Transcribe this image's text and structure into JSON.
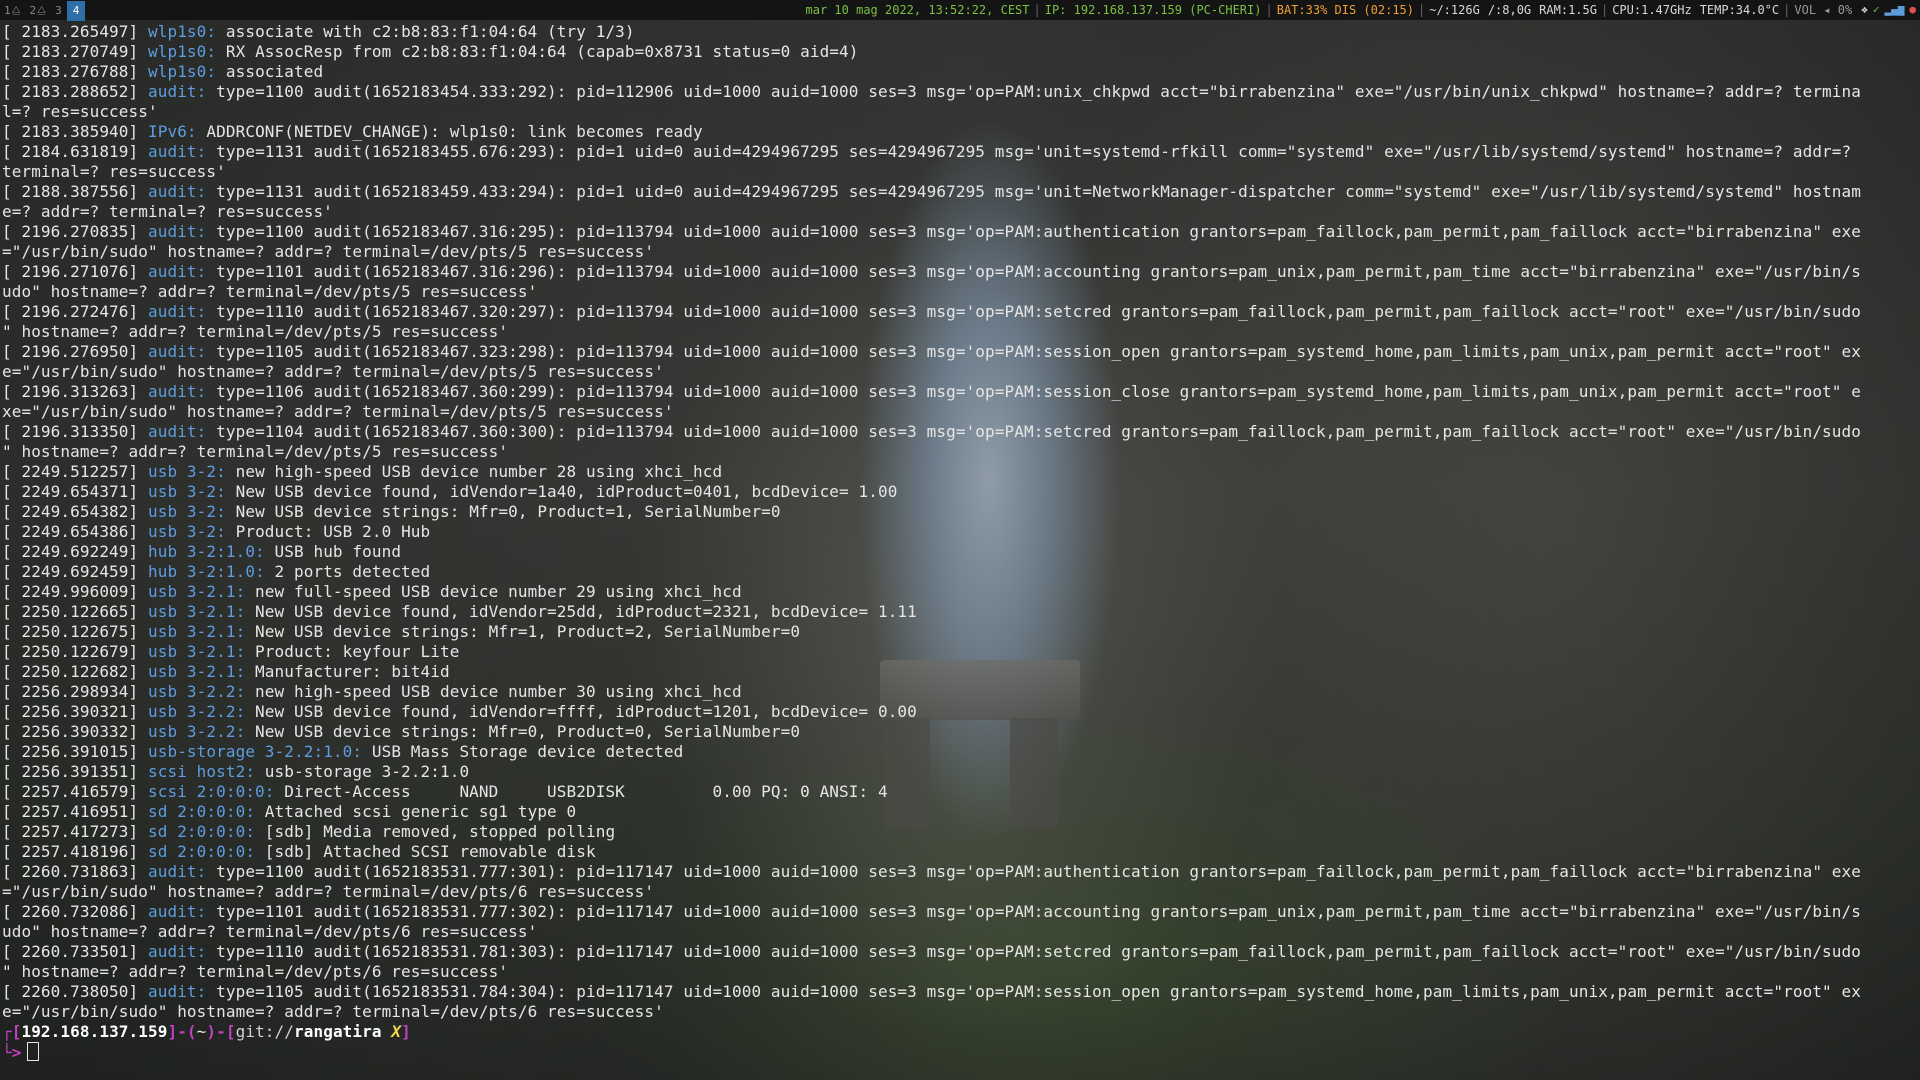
{
  "topbar": {
    "workspaces": [
      {
        "label": "1",
        "active": false
      },
      {
        "label": "2",
        "active": false
      },
      {
        "label": "3",
        "active": false
      },
      {
        "label": "4",
        "active": true
      }
    ],
    "datetime": "mar 10 mag 2022, 13:52:22, CEST",
    "ip": "IP: 192.168.137.159 (PC-CHERI)",
    "battery": "BAT:33% DIS (02:15)",
    "disk_home": "~/:126G",
    "disk_root": "/:8,0G",
    "ram": "RAM:1.5G",
    "cpu": "CPU:1.47GHz",
    "temp": "TEMP:34.0°C",
    "volume": "VOL",
    "volume_level": "0%",
    "colors": {
      "green": "#7bc043",
      "orange": "#f0a030",
      "active_ws": "#2f6fa8"
    }
  },
  "terminal": {
    "lines": [
      {
        "ts": "[ 2183.265497]",
        "src": "wlp1s0:",
        "msg": " associate with c2:b8:83:f1:04:64 (try 1/3)"
      },
      {
        "ts": "[ 2183.270749]",
        "src": "wlp1s0:",
        "msg": " RX AssocResp from c2:b8:83:f1:04:64 (capab=0x8731 status=0 aid=4)"
      },
      {
        "ts": "[ 2183.276788]",
        "src": "wlp1s0:",
        "msg": " associated"
      },
      {
        "ts": "[ 2183.288652]",
        "src": "audit:",
        "msg": " type=1100 audit(1652183454.333:292): pid=112906 uid=1000 auid=1000 ses=3 msg='op=PAM:unix_chkpwd acct=\"birrabenzina\" exe=\"/usr/bin/unix_chkpwd\" hostname=? addr=? termina"
      },
      {
        "ts": "",
        "src": "",
        "msg": "l=? res=success'"
      },
      {
        "ts": "[ 2183.385940]",
        "src": "IPv6:",
        "msg": " ADDRCONF(NETDEV_CHANGE): wlp1s0: link becomes ready"
      },
      {
        "ts": "[ 2184.631819]",
        "src": "audit:",
        "msg": " type=1131 audit(1652183455.676:293): pid=1 uid=0 auid=4294967295 ses=4294967295 msg='unit=systemd-rfkill comm=\"systemd\" exe=\"/usr/lib/systemd/systemd\" hostname=? addr=?"
      },
      {
        "ts": "",
        "src": "",
        "msg": "terminal=? res=success'"
      },
      {
        "ts": "[ 2188.387556]",
        "src": "audit:",
        "msg": " type=1131 audit(1652183459.433:294): pid=1 uid=0 auid=4294967295 ses=4294967295 msg='unit=NetworkManager-dispatcher comm=\"systemd\" exe=\"/usr/lib/systemd/systemd\" hostnam"
      },
      {
        "ts": "",
        "src": "",
        "msg": "e=? addr=? terminal=? res=success'"
      },
      {
        "ts": "[ 2196.270835]",
        "src": "audit:",
        "msg": " type=1100 audit(1652183467.316:295): pid=113794 uid=1000 auid=1000 ses=3 msg='op=PAM:authentication grantors=pam_faillock,pam_permit,pam_faillock acct=\"birrabenzina\" exe"
      },
      {
        "ts": "",
        "src": "",
        "msg": "=\"/usr/bin/sudo\" hostname=? addr=? terminal=/dev/pts/5 res=success'"
      },
      {
        "ts": "[ 2196.271076]",
        "src": "audit:",
        "msg": " type=1101 audit(1652183467.316:296): pid=113794 uid=1000 auid=1000 ses=3 msg='op=PAM:accounting grantors=pam_unix,pam_permit,pam_time acct=\"birrabenzina\" exe=\"/usr/bin/s"
      },
      {
        "ts": "",
        "src": "",
        "msg": "udo\" hostname=? addr=? terminal=/dev/pts/5 res=success'"
      },
      {
        "ts": "[ 2196.272476]",
        "src": "audit:",
        "msg": " type=1110 audit(1652183467.320:297): pid=113794 uid=1000 auid=1000 ses=3 msg='op=PAM:setcred grantors=pam_faillock,pam_permit,pam_faillock acct=\"root\" exe=\"/usr/bin/sudo"
      },
      {
        "ts": "",
        "src": "",
        "msg": "\" hostname=? addr=? terminal=/dev/pts/5 res=success'"
      },
      {
        "ts": "[ 2196.276950]",
        "src": "audit:",
        "msg": " type=1105 audit(1652183467.323:298): pid=113794 uid=1000 auid=1000 ses=3 msg='op=PAM:session_open grantors=pam_systemd_home,pam_limits,pam_unix,pam_permit acct=\"root\" ex"
      },
      {
        "ts": "",
        "src": "",
        "msg": "e=\"/usr/bin/sudo\" hostname=? addr=? terminal=/dev/pts/5 res=success'"
      },
      {
        "ts": "[ 2196.313263]",
        "src": "audit:",
        "msg": " type=1106 audit(1652183467.360:299): pid=113794 uid=1000 auid=1000 ses=3 msg='op=PAM:session_close grantors=pam_systemd_home,pam_limits,pam_unix,pam_permit acct=\"root\" e"
      },
      {
        "ts": "",
        "src": "",
        "msg": "xe=\"/usr/bin/sudo\" hostname=? addr=? terminal=/dev/pts/5 res=success'"
      },
      {
        "ts": "[ 2196.313350]",
        "src": "audit:",
        "msg": " type=1104 audit(1652183467.360:300): pid=113794 uid=1000 auid=1000 ses=3 msg='op=PAM:setcred grantors=pam_faillock,pam_permit,pam_faillock acct=\"root\" exe=\"/usr/bin/sudo"
      },
      {
        "ts": "",
        "src": "",
        "msg": "\" hostname=? addr=? terminal=/dev/pts/5 res=success'"
      },
      {
        "ts": "[ 2249.512257]",
        "src": "usb 3-2:",
        "msg": " new high-speed USB device number 28 using xhci_hcd"
      },
      {
        "ts": "[ 2249.654371]",
        "src": "usb 3-2:",
        "msg": " New USB device found, idVendor=1a40, idProduct=0401, bcdDevice= 1.00"
      },
      {
        "ts": "[ 2249.654382]",
        "src": "usb 3-2:",
        "msg": " New USB device strings: Mfr=0, Product=1, SerialNumber=0"
      },
      {
        "ts": "[ 2249.654386]",
        "src": "usb 3-2:",
        "msg": " Product: USB 2.0 Hub"
      },
      {
        "ts": "[ 2249.692249]",
        "src": "hub 3-2:1.0:",
        "msg": " USB hub found"
      },
      {
        "ts": "[ 2249.692459]",
        "src": "hub 3-2:1.0:",
        "msg": " 2 ports detected"
      },
      {
        "ts": "[ 2249.996009]",
        "src": "usb 3-2.1:",
        "msg": " new full-speed USB device number 29 using xhci_hcd"
      },
      {
        "ts": "[ 2250.122665]",
        "src": "usb 3-2.1:",
        "msg": " New USB device found, idVendor=25dd, idProduct=2321, bcdDevice= 1.11"
      },
      {
        "ts": "[ 2250.122675]",
        "src": "usb 3-2.1:",
        "msg": " New USB device strings: Mfr=1, Product=2, SerialNumber=0"
      },
      {
        "ts": "[ 2250.122679]",
        "src": "usb 3-2.1:",
        "msg": " Product: keyfour Lite"
      },
      {
        "ts": "[ 2250.122682]",
        "src": "usb 3-2.1:",
        "msg": " Manufacturer: bit4id"
      },
      {
        "ts": "[ 2256.298934]",
        "src": "usb 3-2.2:",
        "msg": " new high-speed USB device number 30 using xhci_hcd"
      },
      {
        "ts": "[ 2256.390321]",
        "src": "usb 3-2.2:",
        "msg": " New USB device found, idVendor=ffff, idProduct=1201, bcdDevice= 0.00"
      },
      {
        "ts": "[ 2256.390332]",
        "src": "usb 3-2.2:",
        "msg": " New USB device strings: Mfr=0, Product=0, SerialNumber=0"
      },
      {
        "ts": "[ 2256.391015]",
        "src": "usb-storage 3-2.2:1.0:",
        "msg": " USB Mass Storage device detected"
      },
      {
        "ts": "[ 2256.391351]",
        "src": "scsi host2:",
        "msg": " usb-storage 3-2.2:1.0"
      },
      {
        "ts": "[ 2257.416579]",
        "src": "scsi 2:0:0:0:",
        "msg": " Direct-Access     NAND     USB2DISK         0.00 PQ: 0 ANSI: 4"
      },
      {
        "ts": "[ 2257.416951]",
        "src": "sd 2:0:0:0:",
        "msg": " Attached scsi generic sg1 type 0"
      },
      {
        "ts": "[ 2257.417273]",
        "src": "sd 2:0:0:0:",
        "msg": " [sdb] Media removed, stopped polling"
      },
      {
        "ts": "[ 2257.418196]",
        "src": "sd 2:0:0:0:",
        "msg": " [sdb] Attached SCSI removable disk"
      },
      {
        "ts": "[ 2260.731863]",
        "src": "audit:",
        "msg": " type=1100 audit(1652183531.777:301): pid=117147 uid=1000 auid=1000 ses=3 msg='op=PAM:authentication grantors=pam_faillock,pam_permit,pam_faillock acct=\"birrabenzina\" exe"
      },
      {
        "ts": "",
        "src": "",
        "msg": "=\"/usr/bin/sudo\" hostname=? addr=? terminal=/dev/pts/6 res=success'"
      },
      {
        "ts": "[ 2260.732086]",
        "src": "audit:",
        "msg": " type=1101 audit(1652183531.777:302): pid=117147 uid=1000 auid=1000 ses=3 msg='op=PAM:accounting grantors=pam_unix,pam_permit,pam_time acct=\"birrabenzina\" exe=\"/usr/bin/s"
      },
      {
        "ts": "",
        "src": "",
        "msg": "udo\" hostname=? addr=? terminal=/dev/pts/6 res=success'"
      },
      {
        "ts": "[ 2260.733501]",
        "src": "audit:",
        "msg": " type=1110 audit(1652183531.781:303): pid=117147 uid=1000 auid=1000 ses=3 msg='op=PAM:setcred grantors=pam_faillock,pam_permit,pam_faillock acct=\"root\" exe=\"/usr/bin/sudo"
      },
      {
        "ts": "",
        "src": "",
        "msg": "\" hostname=? addr=? terminal=/dev/pts/6 res=success'"
      },
      {
        "ts": "[ 2260.738050]",
        "src": "audit:",
        "msg": " type=1105 audit(1652183531.784:304): pid=117147 uid=1000 auid=1000 ses=3 msg='op=PAM:session_open grantors=pam_systemd_home,pam_limits,pam_unix,pam_permit acct=\"root\" ex"
      },
      {
        "ts": "",
        "src": "",
        "msg": "e=\"/usr/bin/sudo\" hostname=? addr=? terminal=/dev/pts/6 res=success'"
      }
    ],
    "prompt": {
      "ip": "192.168.137.159",
      "dir": "~",
      "git_prefix": "git://",
      "repo": "rangatira",
      "dirty": "X",
      "arrow": "└>"
    },
    "colors": {
      "source": "#5e9cde",
      "prompt": "#c33fc3",
      "dirty": "#f2d94e"
    }
  }
}
